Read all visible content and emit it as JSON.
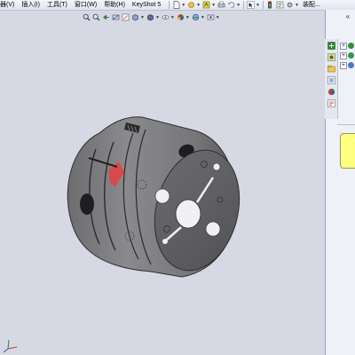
{
  "menubar": {
    "items": [
      {
        "label": "器(V)"
      },
      {
        "label": "插入(I)"
      },
      {
        "label": "工具(T)"
      },
      {
        "label": "窗口(W)"
      },
      {
        "label": "帮助(H)"
      },
      {
        "label": "KeyShot 5"
      }
    ],
    "overflow_label": "装配..."
  },
  "toolbar": {
    "icons": [
      "new-document-icon",
      "options-icon",
      "rebuild-icon",
      "print-icon",
      "undo-icon",
      "select-icon",
      "traffic-light-icon",
      "file-properties-icon",
      "options-gear-icon"
    ]
  },
  "viewbar": {
    "icons": [
      "zoom-to-fit-icon",
      "zoom-area-icon",
      "previous-view-icon",
      "section-view-icon",
      "dynamic-annotation-icon",
      "view-orientation-icon",
      "display-style-icon",
      "hide-show-icon",
      "edit-appearance-icon",
      "apply-scene-icon",
      "view-settings-icon"
    ]
  },
  "taskpane": {
    "collapse_glyph": "«",
    "tabs": [
      "solidworks-resources-icon",
      "design-library-icon",
      "file-explorer-icon",
      "view-palette-icon",
      "appearances-icon",
      "custom-properties-icon"
    ],
    "tree_items": [
      "expand-icon",
      "expand-icon",
      "expand-icon"
    ]
  },
  "colors": {
    "viewport_background": "#d6d9e4",
    "model_body": "#7b7b7d",
    "model_face": "#5f5f61",
    "selection_highlight": "#d84a4a",
    "note_box": "#ffff80"
  }
}
